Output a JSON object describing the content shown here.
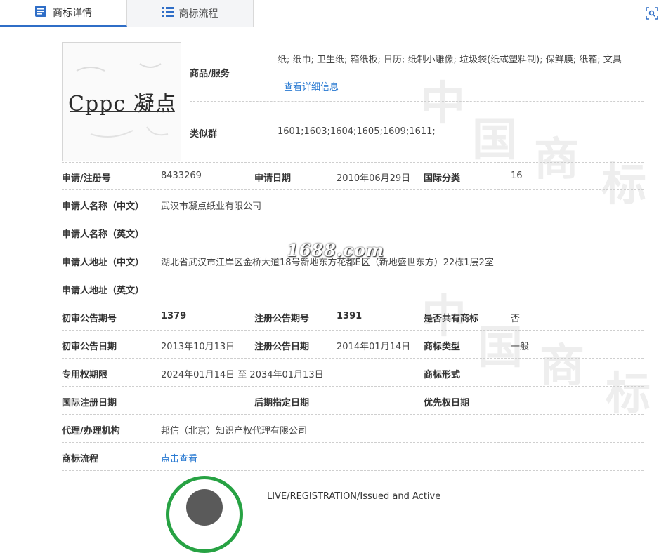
{
  "tabs": [
    {
      "label": "商标详情"
    },
    {
      "label": "商标流程"
    }
  ],
  "logo": {
    "text": "Cppc 凝点"
  },
  "goods": {
    "label": "商品/服务",
    "value": "纸; 纸巾; 卫生纸; 箱纸板; 日历; 纸制小雕像; 垃圾袋(纸或塑料制); 保鲜膜; 纸箱; 文具",
    "link": "查看详细信息"
  },
  "similar": {
    "label": "类似群",
    "value": "1601;1603;1604;1605;1609;1611;"
  },
  "rows": {
    "reg_no": {
      "label": "申请/注册号",
      "value": "8433269"
    },
    "apply_date": {
      "label": "申请日期",
      "value": "2010年06月29日"
    },
    "intl_class": {
      "label": "国际分类",
      "value": "16"
    },
    "applicant_cn": {
      "label": "申请人名称（中文）",
      "value": "武汉市凝点纸业有限公司"
    },
    "applicant_en": {
      "label": "申请人名称（英文）",
      "value": ""
    },
    "address_cn": {
      "label": "申请人地址（中文）",
      "value": "湖北省武汉市江岸区金桥大道18号新地东方花都E区（新地盛世东方）22栋1层2室"
    },
    "address_en": {
      "label": "申请人地址（英文）",
      "value": ""
    },
    "prelim_no": {
      "label": "初审公告期号",
      "value": "1379"
    },
    "reg_pub_no": {
      "label": "注册公告期号",
      "value": "1391"
    },
    "shared": {
      "label": "是否共有商标",
      "value": "否"
    },
    "prelim_date": {
      "label": "初审公告日期",
      "value": "2013年10月13日"
    },
    "reg_pub_date": {
      "label": "注册公告日期",
      "value": "2014年01月14日"
    },
    "mark_type": {
      "label": "商标类型",
      "value": "一般"
    },
    "exclusive": {
      "label": "专用权期限",
      "value": "2024年01月14日 至 2034年01月13日"
    },
    "mark_form": {
      "label": "商标形式",
      "value": ""
    },
    "intl_reg_date": {
      "label": "国际注册日期",
      "value": ""
    },
    "later_date": {
      "label": "后期指定日期",
      "value": ""
    },
    "priority_date": {
      "label": "优先权日期",
      "value": ""
    },
    "agent": {
      "label": "代理/办理机构",
      "value": "邦信（北京）知识产权代理有限公司"
    },
    "flow": {
      "label": "商标流程",
      "link": "点击查看"
    }
  },
  "watermark": "1688.com",
  "status": "LIVE/REGISTRATION/Issued and Active",
  "colors": {
    "accent": "#2f6ec7",
    "link": "#2a7ad2",
    "badge": "#27a243"
  }
}
